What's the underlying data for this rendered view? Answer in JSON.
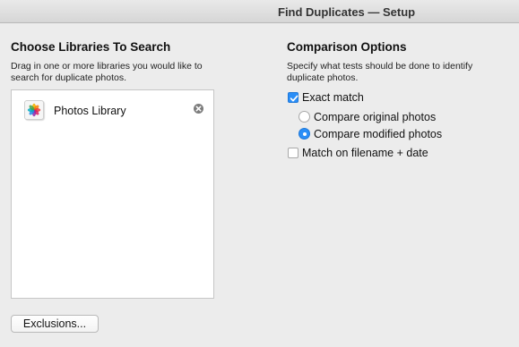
{
  "window": {
    "title": "Find Duplicates — Setup"
  },
  "libraries": {
    "heading": "Choose Libraries To Search",
    "description": "Drag in one or more libraries you would like to search for duplicate photos.",
    "items": [
      {
        "label": "Photos Library",
        "icon": "photos-app-icon"
      }
    ]
  },
  "comparison": {
    "heading": "Comparison Options",
    "description": "Specify what tests should be done to identify duplicate photos.",
    "exact_match": {
      "label": "Exact match",
      "checked": true
    },
    "compare_original": {
      "label": "Compare original photos",
      "selected": false
    },
    "compare_modified": {
      "label": "Compare modified photos",
      "selected": true
    },
    "filename_date": {
      "label": "Match on filename + date",
      "checked": false
    }
  },
  "footer": {
    "exclusions_label": "Exclusions..."
  },
  "colors": {
    "accent": "#2a8ef7",
    "window_bg": "#ececec"
  }
}
